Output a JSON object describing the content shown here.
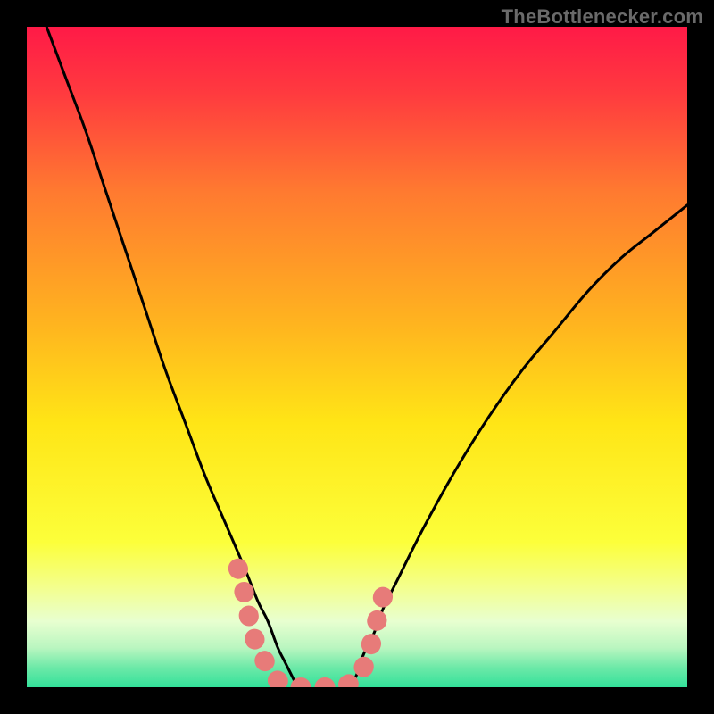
{
  "watermark": "TheBottlenecker.com",
  "chart_data": {
    "type": "line",
    "title": "",
    "xlabel": "",
    "ylabel": "",
    "xlim": [
      0,
      100
    ],
    "ylim": [
      0,
      100
    ],
    "grid": false,
    "background_gradient": {
      "stops": [
        {
          "offset": 0.0,
          "color": "#ff1a47"
        },
        {
          "offset": 0.1,
          "color": "#ff3a3f"
        },
        {
          "offset": 0.25,
          "color": "#ff7a30"
        },
        {
          "offset": 0.45,
          "color": "#ffb41f"
        },
        {
          "offset": 0.6,
          "color": "#ffe516"
        },
        {
          "offset": 0.78,
          "color": "#fcff3a"
        },
        {
          "offset": 0.85,
          "color": "#f3ff8f"
        },
        {
          "offset": 0.9,
          "color": "#e8ffd0"
        },
        {
          "offset": 0.94,
          "color": "#baf6c0"
        },
        {
          "offset": 0.97,
          "color": "#6de9a8"
        },
        {
          "offset": 1.0,
          "color": "#33e19a"
        }
      ]
    },
    "series": [
      {
        "name": "left-curve",
        "stroke": "#000000",
        "x": [
          3,
          6,
          9,
          12,
          15,
          18,
          21,
          24,
          27,
          30,
          33,
          35,
          36.5,
          38,
          39,
          40,
          41
        ],
        "y": [
          100,
          92,
          84,
          75,
          66,
          57,
          48,
          40,
          32,
          25,
          18,
          13,
          10,
          6,
          4,
          2,
          0
        ]
      },
      {
        "name": "right-curve",
        "stroke": "#000000",
        "x": [
          49,
          50,
          51,
          52.5,
          54,
          56,
          60,
          65,
          70,
          75,
          80,
          85,
          90,
          95,
          100
        ],
        "y": [
          0,
          2,
          5,
          8,
          12,
          16,
          24,
          33,
          41,
          48,
          54,
          60,
          65,
          69,
          73
        ]
      },
      {
        "name": "valley-band",
        "type": "area",
        "stroke": "#e77b79",
        "x": [
          32,
          33,
          34,
          35,
          36,
          37,
          38,
          39,
          40,
          41,
          42,
          43,
          44,
          45,
          46,
          47,
          48,
          49,
          50,
          51,
          52,
          53,
          54
        ],
        "y": [
          18,
          14,
          9,
          6,
          4,
          2,
          1,
          0.5,
          0.2,
          0,
          0,
          0,
          0,
          0,
          0,
          0,
          0.2,
          0.6,
          1.2,
          3,
          6,
          10,
          14
        ]
      }
    ],
    "annotations": []
  }
}
